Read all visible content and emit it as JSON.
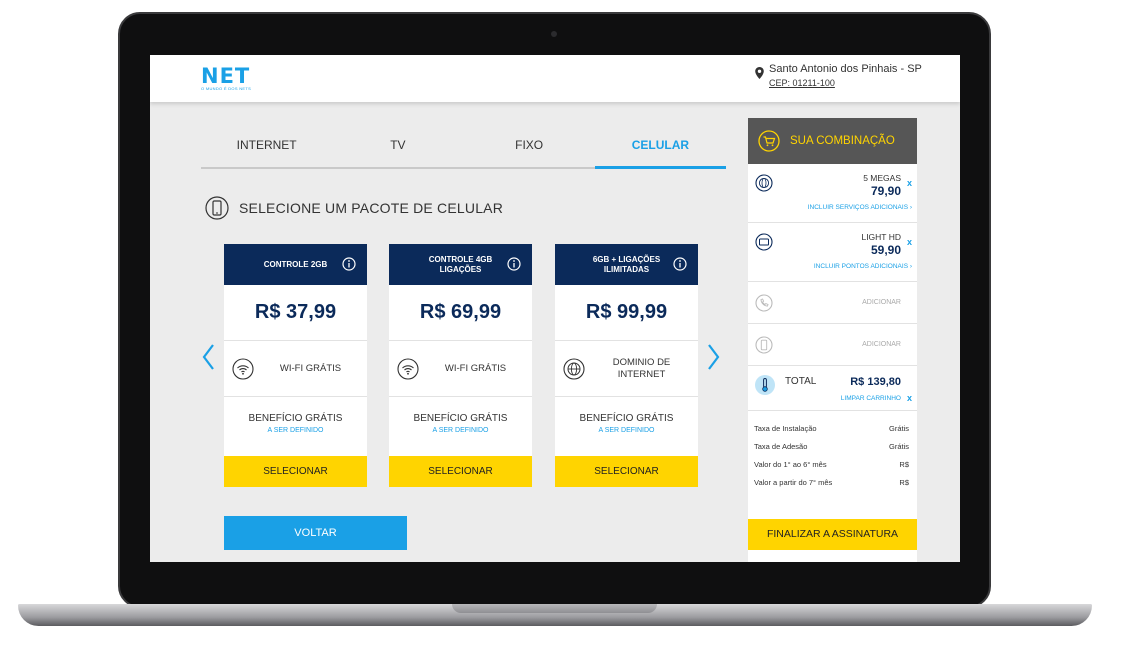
{
  "brand": {
    "logo": "NET",
    "tagline": "O MUNDO É DOS NETS"
  },
  "location": {
    "city": "Santo Antonio dos Pinhais - SP",
    "cep": "CEP: 01211-100"
  },
  "tabs": [
    {
      "label": "INTERNET",
      "active": false
    },
    {
      "label": "TV",
      "active": false
    },
    {
      "label": "FIXO",
      "active": false
    },
    {
      "label": "CELULAR",
      "active": true
    }
  ],
  "section_title": "SELECIONE UM PACOTE DE CELULAR",
  "plans": [
    {
      "title": "CONTROLE 2GB",
      "price": "R$ 37,99",
      "feature": "WI-FI GRÁTIS",
      "feature_icon": "wifi-icon",
      "benefit": "BENEFÍCIO GRÁTIS",
      "benefit_sub": "A SER DEFINIDO",
      "button": "SELECIONAR"
    },
    {
      "title": "CONTROLE 4GB LIGAÇÕES",
      "price": "R$ 69,99",
      "feature": "WI-FI GRÁTIS",
      "feature_icon": "wifi-icon",
      "benefit": "BENEFÍCIO GRÁTIS",
      "benefit_sub": "A SER DEFINIDO",
      "button": "SELECIONAR"
    },
    {
      "title": "6GB + LIGAÇÕES ILIMITADAS",
      "price": "R$ 99,99",
      "feature": "DOMINIO DE INTERNET",
      "feature_icon": "globe-icon",
      "benefit": "BENEFÍCIO GRÁTIS",
      "benefit_sub": "A SER DEFINIDO",
      "button": "SELECIONAR"
    }
  ],
  "back_button": "VOLTAR",
  "combo": {
    "title": "SUA COMBINAÇÃO",
    "items": [
      {
        "name": "5 MEGAS",
        "price": "79,90",
        "remove": "x",
        "link": "INCLUIR SERVIÇOS ADICIONAIS ›"
      },
      {
        "name": "LIGHT HD",
        "price": "59,90",
        "remove": "x",
        "link": "INCLUIR PONTOS ADICIONAIS ›"
      }
    ],
    "add_label_1": "ADICIONAR",
    "add_label_2": "ADICIONAR",
    "total_label": "TOTAL",
    "total_value": "R$ 139,80",
    "clear_cart": "LIMPAR CARRINHO",
    "clear_x": "x",
    "summary": [
      {
        "label": "Taxa de Instalação",
        "value": "Grátis"
      },
      {
        "label": "Taxa de Adesão",
        "value": "Grátis"
      },
      {
        "label": "Valor do 1° ao 6° mês",
        "value": "R$"
      },
      {
        "label": "Valor a partir do 7° mês",
        "value": "R$"
      }
    ],
    "finish_button": "FINALIZAR A ASSINATURA"
  },
  "colors": {
    "accent": "#1aa0e6",
    "navy": "#0b2a5a",
    "yellow": "#ffd400",
    "panel_head": "#565656"
  }
}
